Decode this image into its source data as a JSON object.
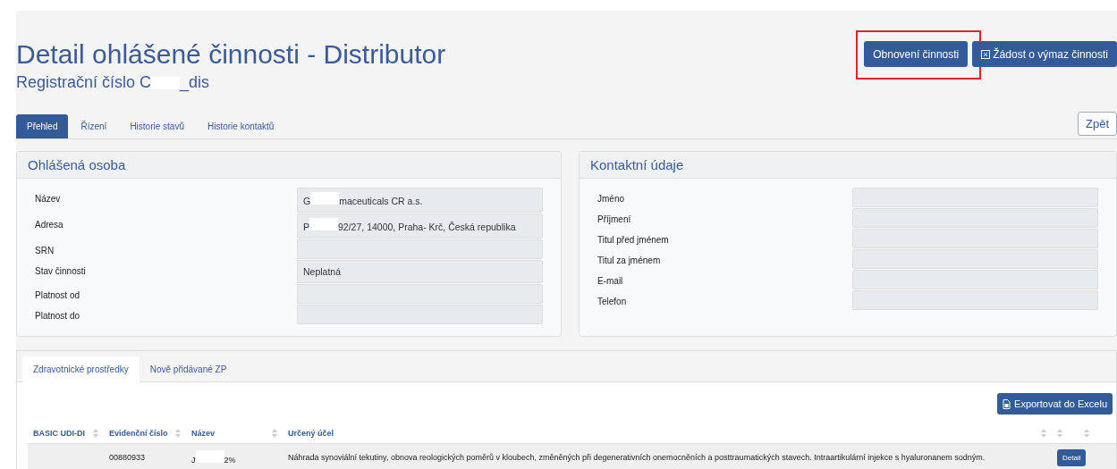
{
  "header": {
    "title": "Detail ohlášené činnosti - Distributor",
    "registration": [
      {
        "kind": "text",
        "text": "Registrační číslo C"
      },
      {
        "kind": "redacted"
      },
      {
        "kind": "text",
        "text": "_dis"
      }
    ]
  },
  "actions": [
    {
      "label": "Obnovení činnosti",
      "kind": "plain",
      "highlighted": true
    },
    {
      "label": "Žádost o výmaz činnosti",
      "kind": "remove",
      "highlighted": false
    }
  ],
  "tabs": [
    {
      "label": "Přehled",
      "selected": true
    },
    {
      "label": "Řízení",
      "selected": false
    },
    {
      "label": "Historie stavů",
      "selected": false
    },
    {
      "label": "Historie kontaktů",
      "selected": false
    }
  ],
  "back_button": "Zpět",
  "panels": [
    {
      "title": "Ohlášená osoba",
      "fields": [
        {
          "label": "Název",
          "value": [
            {
              "kind": "text",
              "text": "G"
            },
            {
              "kind": "redacted"
            },
            {
              "kind": "text",
              "text": "maceuticals CR a.s."
            }
          ]
        },
        {
          "label": "Adresa",
          "value": [
            {
              "kind": "text",
              "text": "P"
            },
            {
              "kind": "redacted"
            },
            {
              "kind": "text",
              "text": "92/27, 14000, Praha- Krč, Česká republika"
            }
          ]
        },
        {
          "label": "SRN"
        },
        {
          "label": "Stav činnosti",
          "value": [
            {
              "kind": "text",
              "text": "Neplatná"
            }
          ]
        },
        {
          "label": "Platnost od"
        },
        {
          "label": "Platnost do"
        }
      ]
    },
    {
      "title": "Kontaktní údaje",
      "fields": [
        {
          "label": "Jméno"
        },
        {
          "label": "Příjmení"
        },
        {
          "label": "Titul před jménem"
        },
        {
          "label": "Titul za jménem"
        },
        {
          "label": "E-mail"
        },
        {
          "label": "Telefon"
        }
      ]
    }
  ],
  "device_tabs": [
    {
      "label": "Zdravotnické prostředky",
      "selected": true
    },
    {
      "label": "Nově přidávané ZP",
      "selected": false
    }
  ],
  "export_button": "Exportovat do Excelu",
  "table": {
    "columns": [
      {
        "label": "BASIC UDI-DI"
      },
      {
        "label": "Evidenční číslo"
      },
      {
        "label": "Název"
      },
      {
        "label": "Určený účel"
      },
      {},
      {}
    ],
    "rows": [
      {
        "cells": [
          {},
          {
            "segments": [
              {
                "kind": "text",
                "text": "00880933"
              }
            ]
          },
          {
            "segments": [
              {
                "kind": "text",
                "text": "J"
              },
              {
                "kind": "redacted"
              },
              {
                "kind": "text",
                "text": "2%"
              }
            ]
          },
          {
            "segments": [
              {
                "kind": "text",
                "text": "Náhrada synoviální tekutiny, obnova reologických poměrů v kloubech, změněných při degenerativních onemocněních a posttraumatických stavech. Intraartikulární injekce s hyaluronanem sodným."
              }
            ]
          }
        ],
        "action": "Detail"
      }
    ]
  }
}
